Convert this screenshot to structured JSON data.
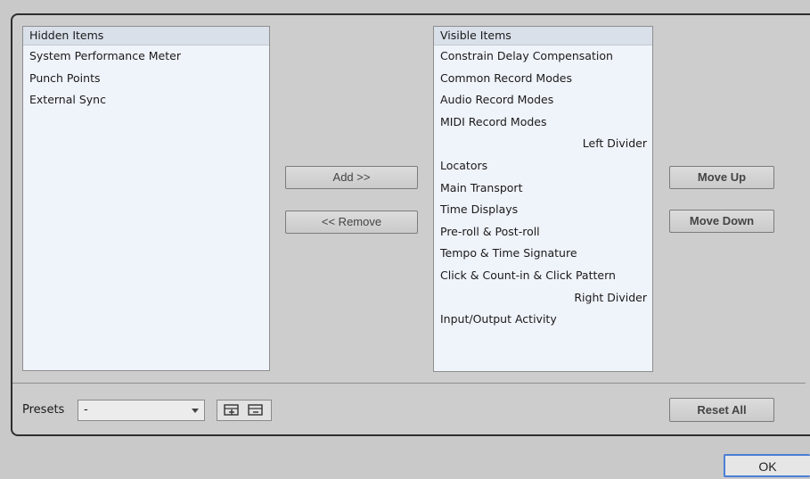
{
  "hidden_list": {
    "header": "Hidden Items",
    "items": [
      "System Performance Meter",
      "Punch Points",
      "External Sync"
    ]
  },
  "visible_list": {
    "header": "Visible Items",
    "items": [
      "Constrain Delay Compensation",
      "Common Record Modes",
      "Audio Record Modes",
      "MIDI Record Modes",
      "Left Divider",
      "Locators",
      "Main Transport",
      "Time Displays",
      "Pre-roll & Post-roll",
      "Tempo & Time Signature",
      "Click & Count-in & Click Pattern",
      "Right Divider",
      "Input/Output Activity"
    ]
  },
  "buttons": {
    "add": "Add >>",
    "remove": "<< Remove",
    "move_up": "Move Up",
    "move_down": "Move Down",
    "reset_all": "Reset All",
    "ok": "OK"
  },
  "presets": {
    "label": "Presets",
    "selected": "-"
  },
  "icons": {
    "save_preset": "save-preset-icon",
    "remove_preset": "remove-preset-icon"
  }
}
